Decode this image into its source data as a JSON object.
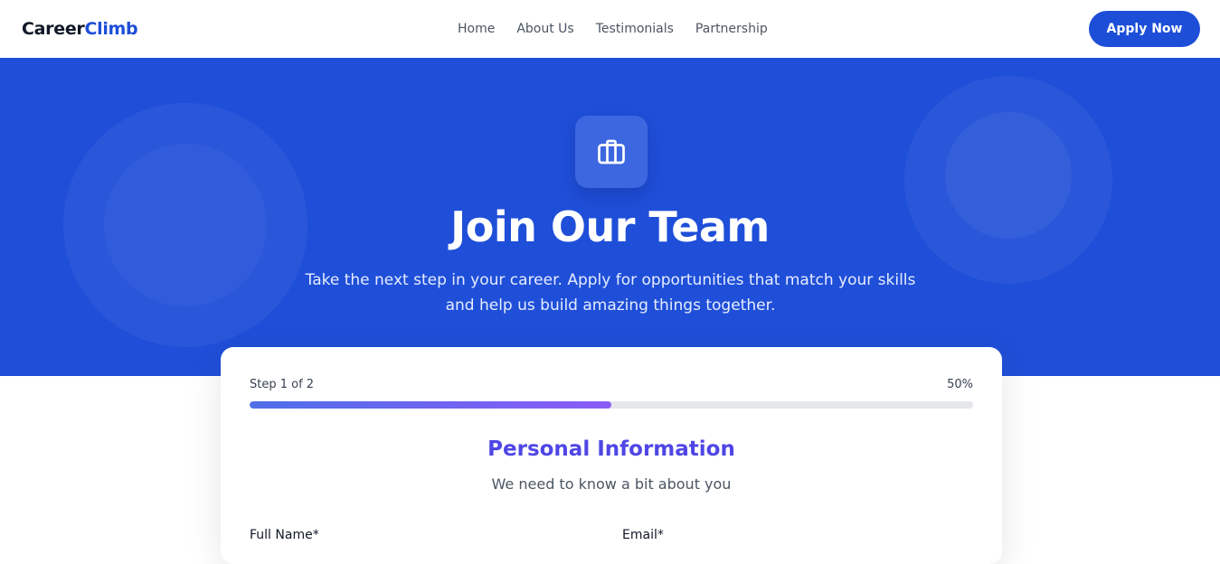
{
  "header": {
    "logo_primary": "Career",
    "logo_accent": "Climb",
    "nav": [
      "Home",
      "About Us",
      "Testimonials",
      "Partnership"
    ],
    "apply_label": "Apply Now"
  },
  "hero": {
    "icon": "briefcase-icon",
    "title": "Join Our Team",
    "subtitle": "Take the next step in your career. Apply for opportunities that match your skills and help us build amazing things together."
  },
  "form": {
    "step_label": "Step 1 of 2",
    "progress_text": "50%",
    "progress_value": 0.5,
    "section_title": "Personal Information",
    "section_subtitle": "We need to know a bit about you",
    "fields": [
      {
        "label": "Full Name*"
      },
      {
        "label": "Email*"
      }
    ]
  },
  "colors": {
    "brand": "#1d4ed8",
    "hero_bg": "#1f4fd8",
    "section_title": "#4f46e5",
    "progress_start": "#4f6ee8",
    "progress_end": "#8b5cf6"
  }
}
